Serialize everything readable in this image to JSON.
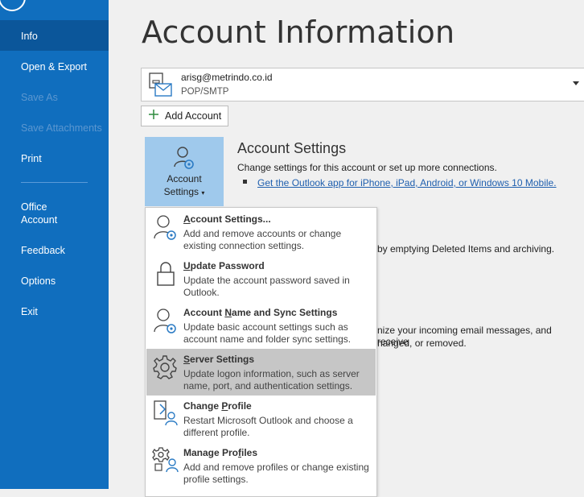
{
  "sidebar": {
    "items": [
      {
        "label": "Info"
      },
      {
        "label": "Open & Export"
      },
      {
        "label": "Save As"
      },
      {
        "label": "Save Attachments"
      },
      {
        "label": "Print"
      },
      {
        "label": "Office Account"
      },
      {
        "label": "Feedback"
      },
      {
        "label": "Options"
      },
      {
        "label": "Exit"
      }
    ]
  },
  "main": {
    "title": "Account Information",
    "account": {
      "email": "arisg@metrindo.co.id",
      "type": "POP/SMTP"
    },
    "add_account_label": "Add Account",
    "account_settings": {
      "tile_label_line1": "Account",
      "tile_label_line2": "Settings",
      "title": "Account Settings",
      "description": "Change settings for this account or set up more connections.",
      "link": "Get the Outlook app for iPhone, iPad, Android, or Windows 10 Mobile."
    },
    "background_text": {
      "cleanup": "by emptying Deleted Items and archiving.",
      "rules_line1": "nize your incoming email messages, and receive",
      "rules_line2": "hanged, or removed."
    }
  },
  "menu": {
    "items": [
      {
        "pre": "",
        "ul": "A",
        "post": "ccount Settings...",
        "desc": "Add and remove accounts or change existing connection settings.",
        "icon": "person-gear-icon"
      },
      {
        "pre": "",
        "ul": "U",
        "post": "pdate Password",
        "desc": "Update the account password saved in Outlook.",
        "icon": "lock-icon"
      },
      {
        "pre": "Account ",
        "ul": "N",
        "post": "ame and Sync Settings",
        "desc": "Update basic account settings such as account name and folder sync settings.",
        "icon": "person-gear-icon"
      },
      {
        "pre": "",
        "ul": "S",
        "post": "erver Settings",
        "desc": "Update logon information, such as server name, port, and authentication settings.",
        "icon": "gear-icon"
      },
      {
        "pre": "Change ",
        "ul": "P",
        "post": "rofile",
        "desc": "Restart Microsoft Outlook and choose a different profile.",
        "icon": "change-profile-icon"
      },
      {
        "pre": "Manage Pro",
        "ul": "f",
        "post": "iles",
        "desc": "Add and remove profiles or change existing profile settings.",
        "icon": "manage-profiles-icon"
      }
    ]
  },
  "colors": {
    "sidebar": "#106ebe",
    "sidebar_active": "#0b569a",
    "tile": "#9fc9ec",
    "menu_highlight": "#c6c6c6"
  }
}
